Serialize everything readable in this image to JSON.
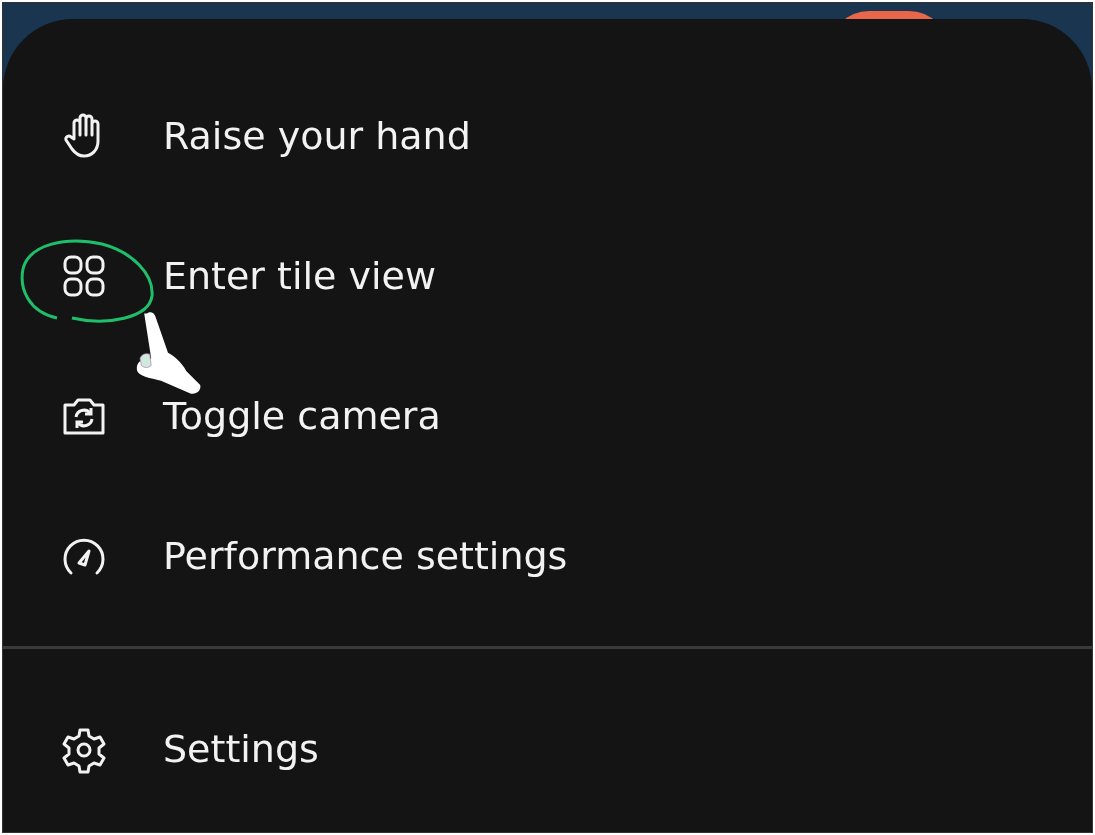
{
  "sections": [
    [
      {
        "label": "Raise your hand",
        "circled": false
      },
      {
        "label": "Enter tile view",
        "circled": true
      },
      {
        "label": "Toggle camera",
        "circled": false
      },
      {
        "label": "Performance settings",
        "circled": false
      }
    ],
    [
      {
        "label": "Settings",
        "circled": false
      }
    ]
  ]
}
